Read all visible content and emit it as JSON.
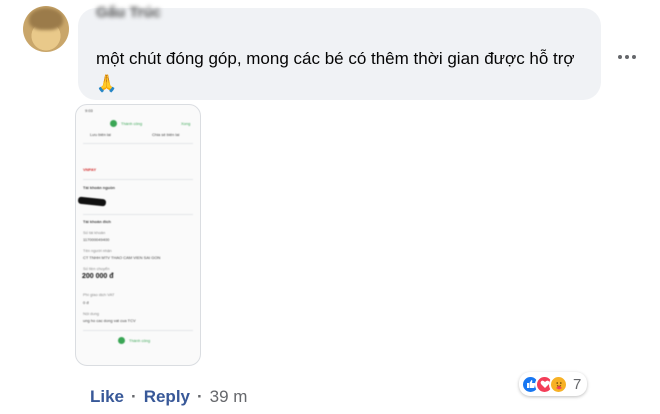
{
  "comment": {
    "author": "Gấu Trúc",
    "text": "một chút đóng góp, mong các bé có thêm thời gian được hỗ trợ🙏",
    "time": "39 m"
  },
  "actions": {
    "like": "Like",
    "reply": "Reply",
    "separator": "·"
  },
  "reactions": {
    "icons": [
      "like-icon",
      "love-icon",
      "care-icon"
    ],
    "count": "7"
  },
  "attachment": {
    "status_time": "9:03",
    "success": "Thành công",
    "done": "Xong",
    "save_receipt": "Lưu biên lai",
    "share_receipt": "Chia sẻ biên lai",
    "vnpay": "VNPAY",
    "source_account": "Tài khoản nguồn",
    "dest_account": "Tài khoản đích",
    "account_number_label": "Số tài khoản",
    "account_number": "117000049400",
    "recipient_label": "Tên người nhận",
    "recipient": "CT TNHH MTV THAO CAM VIEN SAI GON",
    "amount_label": "Số tiền chuyển",
    "amount": "200 000 đ",
    "fee_label": "Phí giao dịch VAT",
    "fee": "0 đ",
    "content_label": "Nội dung",
    "content": "ung ho cac dong vat cua TCV",
    "footer_success": "Thành công"
  },
  "colors": {
    "link": "#385898",
    "bubble": "#f0f2f5",
    "success": "#3aa655"
  }
}
